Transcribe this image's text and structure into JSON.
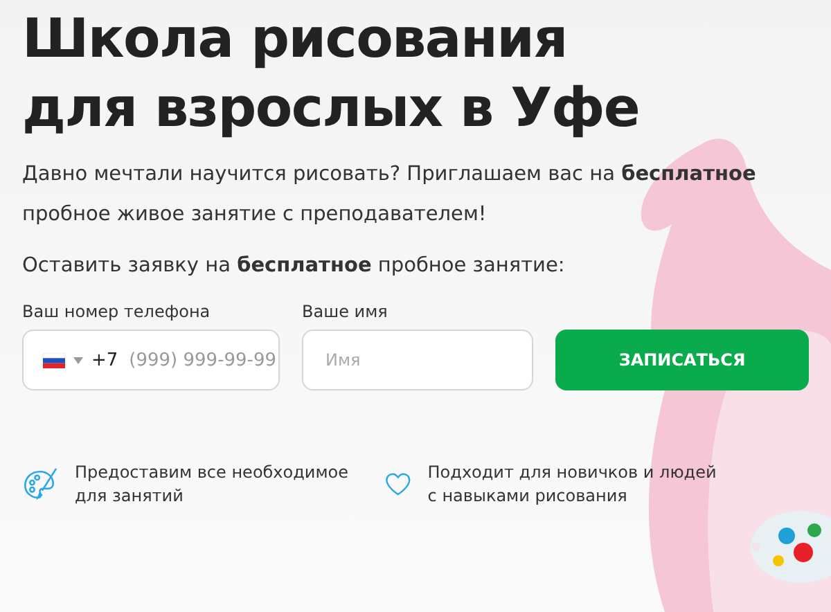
{
  "hero": {
    "title": "Школа рисования для взрослых в Уфе",
    "intro": "Давно мечтали научится рисовать? Приглашаем вас на **бесплатное** пробное живое занятие с преподавателем!",
    "form_prompt": "Оставить заявку на **бесплатное** пробное занятие:"
  },
  "form": {
    "phone": {
      "label": "Ваш номер телефона",
      "prefix": "+7",
      "placeholder": "(999) 999-99-99"
    },
    "name": {
      "label": "Ваше имя",
      "placeholder": "Имя"
    },
    "submit": "ЗАПИСАТЬСЯ"
  },
  "features": [
    {
      "kind": "palette",
      "text": "Предоставим все необходимое для занятий"
    },
    {
      "kind": "heart",
      "text": "Подходит для новичков и людей с навыками рисования"
    }
  ]
}
